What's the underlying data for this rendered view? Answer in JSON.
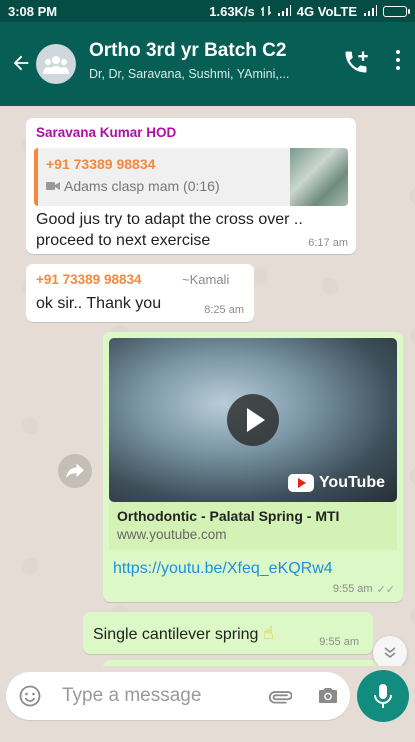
{
  "status_bar": {
    "time": "3:08 PM",
    "network": "1.63K/s",
    "carrier": "4G VoLTE"
  },
  "header": {
    "title": "Ortho 3rd yr Batch C2",
    "subtitle": "Dr, Dr, Saravana, Sushmi, YAmini,...",
    "back_icon": "arrow-left-icon",
    "call_icon": "add-call-icon",
    "menu_icon": "more-vert-icon"
  },
  "messages": [
    {
      "direction": "in",
      "sender": "Saravana Kumar HOD",
      "sender_color": "#b00ea5",
      "quote": {
        "sender": "+91 73389 98834",
        "sender_color": "#f4893c",
        "media_icon": "video-icon",
        "text": "Adams clasp mam (0:16)"
      },
      "text_line1": "Good jus try to adapt the cross over ..",
      "text_line2": "proceed to next exercise",
      "time": "6:17 am"
    },
    {
      "direction": "in",
      "sender": "+91 73389 98834",
      "sender_color": "#f4893c",
      "push_name": "~Kamali",
      "text": "ok sir.. Thank you",
      "time": "8:25 am"
    },
    {
      "direction": "out",
      "link_preview": {
        "title": "Orthodontic - Palatal Spring - MTI",
        "domain": "www.youtube.com",
        "brand": "YouTube"
      },
      "url": "https://youtu.be/Xfeq_eKQRw4",
      "time": "9:55 am",
      "ticks": "✓✓"
    },
    {
      "direction": "out",
      "text": "Single cantilever spring",
      "emoji": "☝",
      "time": "9:55 am"
    }
  ],
  "composer": {
    "placeholder": "Type a message",
    "emoji_icon": "emoji-icon",
    "attach_icon": "paperclip-icon",
    "camera_icon": "camera-icon",
    "mic_icon": "mic-icon"
  },
  "colors": {
    "header": "#075e54",
    "status_bar": "#054d44",
    "outgoing_bubble": "#dcf8c6",
    "incoming_bubble": "#ffffff",
    "link": "#1f8fe0",
    "accent": "#128c7e"
  }
}
